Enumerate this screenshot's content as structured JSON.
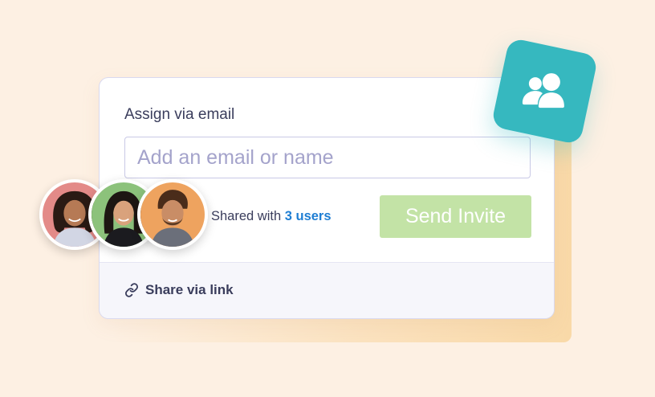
{
  "card": {
    "title": "Assign via email",
    "input_placeholder": "Add an email or name",
    "shared_prefix": "Shared with",
    "shared_count": "3 users",
    "send_button": "Send Invite",
    "share_link": "Share via link"
  },
  "avatars": [
    {
      "name": "avatar-1",
      "bg": "#e38a88"
    },
    {
      "name": "avatar-2",
      "bg": "#8cc27b"
    },
    {
      "name": "avatar-3",
      "bg": "#eea35f"
    }
  ],
  "icons": {
    "badge": "users-icon",
    "link": "link-icon"
  },
  "colors": {
    "background": "#fdf0e3",
    "accent_teal": "#36b8bf",
    "button_disabled": "#c3e3a6",
    "link_blue": "#1f7ed3",
    "text": "#3a3d5c"
  }
}
